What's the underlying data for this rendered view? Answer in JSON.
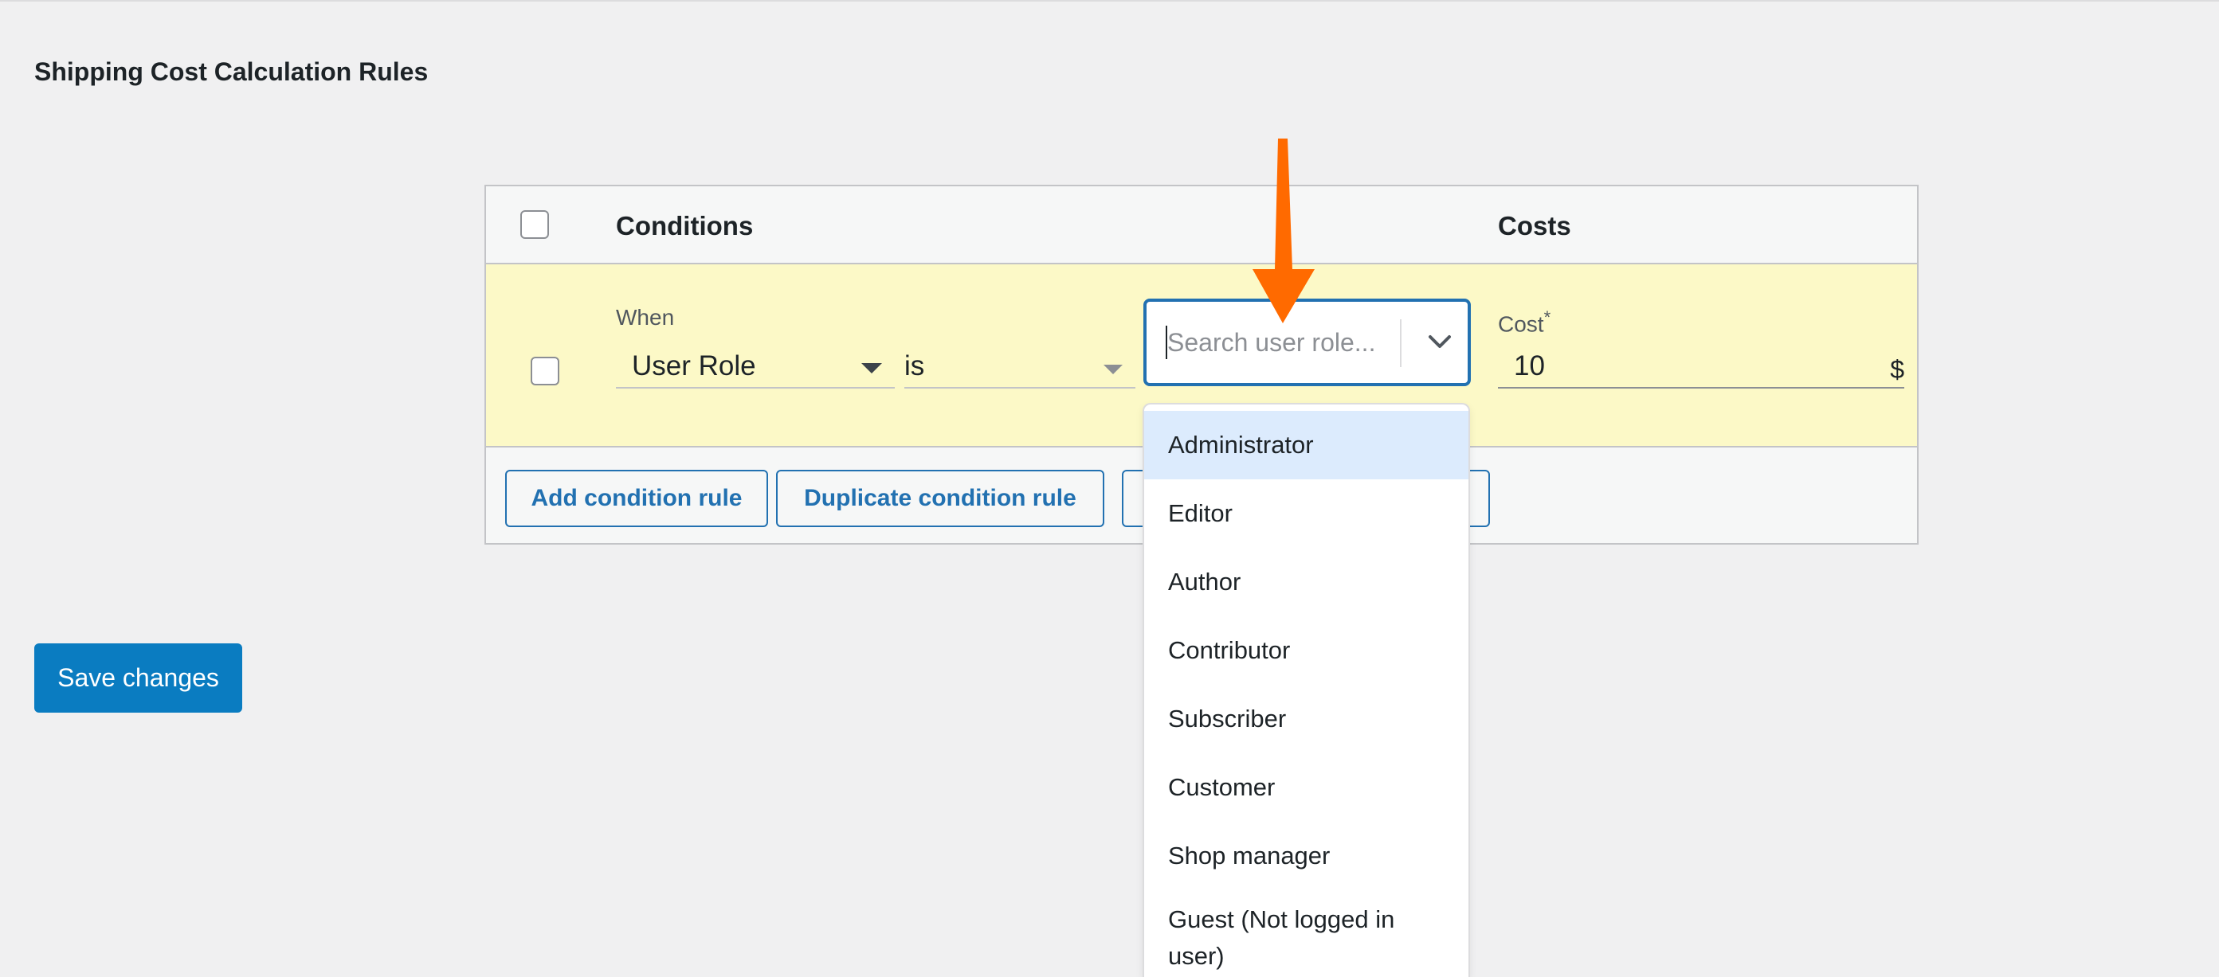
{
  "page_title": "Shipping Cost Calculation Rules",
  "table": {
    "header": {
      "conditions_label": "Conditions",
      "costs_label": "Costs"
    },
    "row": {
      "when_label": "When",
      "condition_value": "User Role",
      "operator_value": "is",
      "search": {
        "placeholder": "Search user role..."
      },
      "cost_label": "Cost",
      "cost_required_mark": "*",
      "cost_value": "10",
      "cost_unit": "$"
    },
    "buttons": {
      "add_label": "Add condition rule",
      "duplicate_label": "Duplicate condition rule"
    }
  },
  "dropdown": {
    "options": [
      "Administrator",
      "Editor",
      "Author",
      "Contributor",
      "Subscriber",
      "Customer",
      "Shop manager",
      "Guest (Not logged in user)"
    ],
    "highlighted_index": 0
  },
  "save_label": "Save changes",
  "colors": {
    "accent": "#2271b1",
    "primary_button": "#0a7cc1",
    "row_highlight": "#fcf9c7",
    "option_highlight": "#dcebfd",
    "annotation_arrow": "#ff6a00"
  },
  "icons": {
    "search_chevron": "chevron-down-icon",
    "select_caret": "caret-down-icon",
    "annotation": "arrow-down-icon"
  }
}
